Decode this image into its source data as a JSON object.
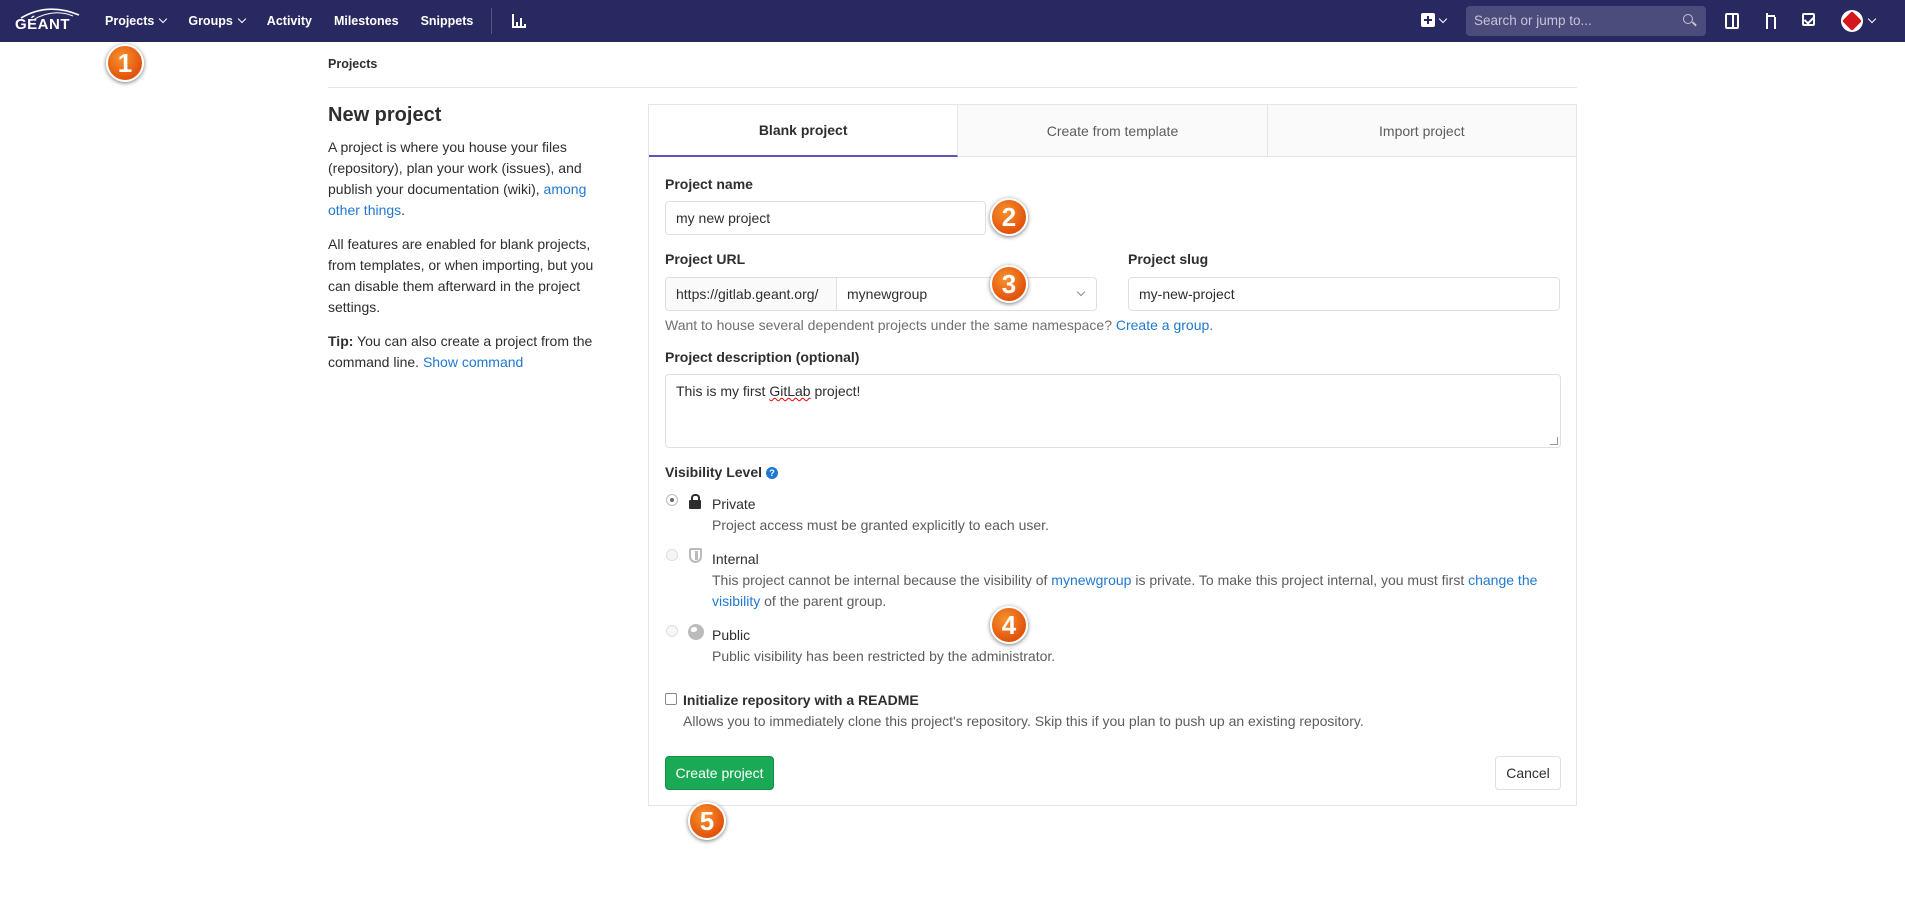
{
  "nav": {
    "logo_text": "GÉANT",
    "items": [
      "Projects",
      "Groups",
      "Activity",
      "Milestones",
      "Snippets"
    ],
    "search_placeholder": "Search or jump to..."
  },
  "breadcrumb": "Projects",
  "intro": {
    "title": "New project",
    "p1_text": "A project is where you house your files (repository), plan your work (issues), and publish your documentation (wiki), ",
    "p1_link": "among other things",
    "p1_end": ".",
    "p2": "All features are enabled for blank projects, from templates, or when importing, but you can disable them afterward in the project settings.",
    "tip_label": "Tip:",
    "tip_text": " You can also create a project from the command line. ",
    "tip_link": "Show command"
  },
  "tabs": [
    "Blank project",
    "Create from template",
    "Import project"
  ],
  "form": {
    "project_name_label": "Project name",
    "project_name_value": "my new project",
    "project_url_label": "Project URL",
    "url_prefix": "https://gitlab.geant.org/",
    "namespace_value": "mynewgroup",
    "slug_label": "Project slug",
    "slug_value": "my-new-project",
    "namespace_help": "Want to house several dependent projects under the same namespace?",
    "namespace_help_link": "Create a group.",
    "description_label": "Project description (optional)",
    "description_prefix": "This is my first ",
    "description_word": "GitLab",
    "description_suffix": " project!",
    "visibility_label": "Visibility Level",
    "visibility": [
      {
        "name": "Private",
        "desc": "Project access must be granted explicitly to each user.",
        "checked": true
      },
      {
        "name": "Internal",
        "desc_a": "This project cannot be internal because the visibility of ",
        "desc_link1": "mynewgroup",
        "desc_b": " is private. To make this project internal, you must first ",
        "desc_link2": "change the visibility",
        "desc_c": " of the parent group."
      },
      {
        "name": "Public",
        "desc": "Public visibility has been restricted by the administrator."
      }
    ],
    "readme_label": "Initialize repository with a README",
    "readme_help": "Allows you to immediately clone this project's repository. Skip this if you plan to push up an existing repository.",
    "create_button": "Create project",
    "cancel_button": "Cancel"
  },
  "markers": [
    "1",
    "2",
    "3",
    "4",
    "5"
  ]
}
